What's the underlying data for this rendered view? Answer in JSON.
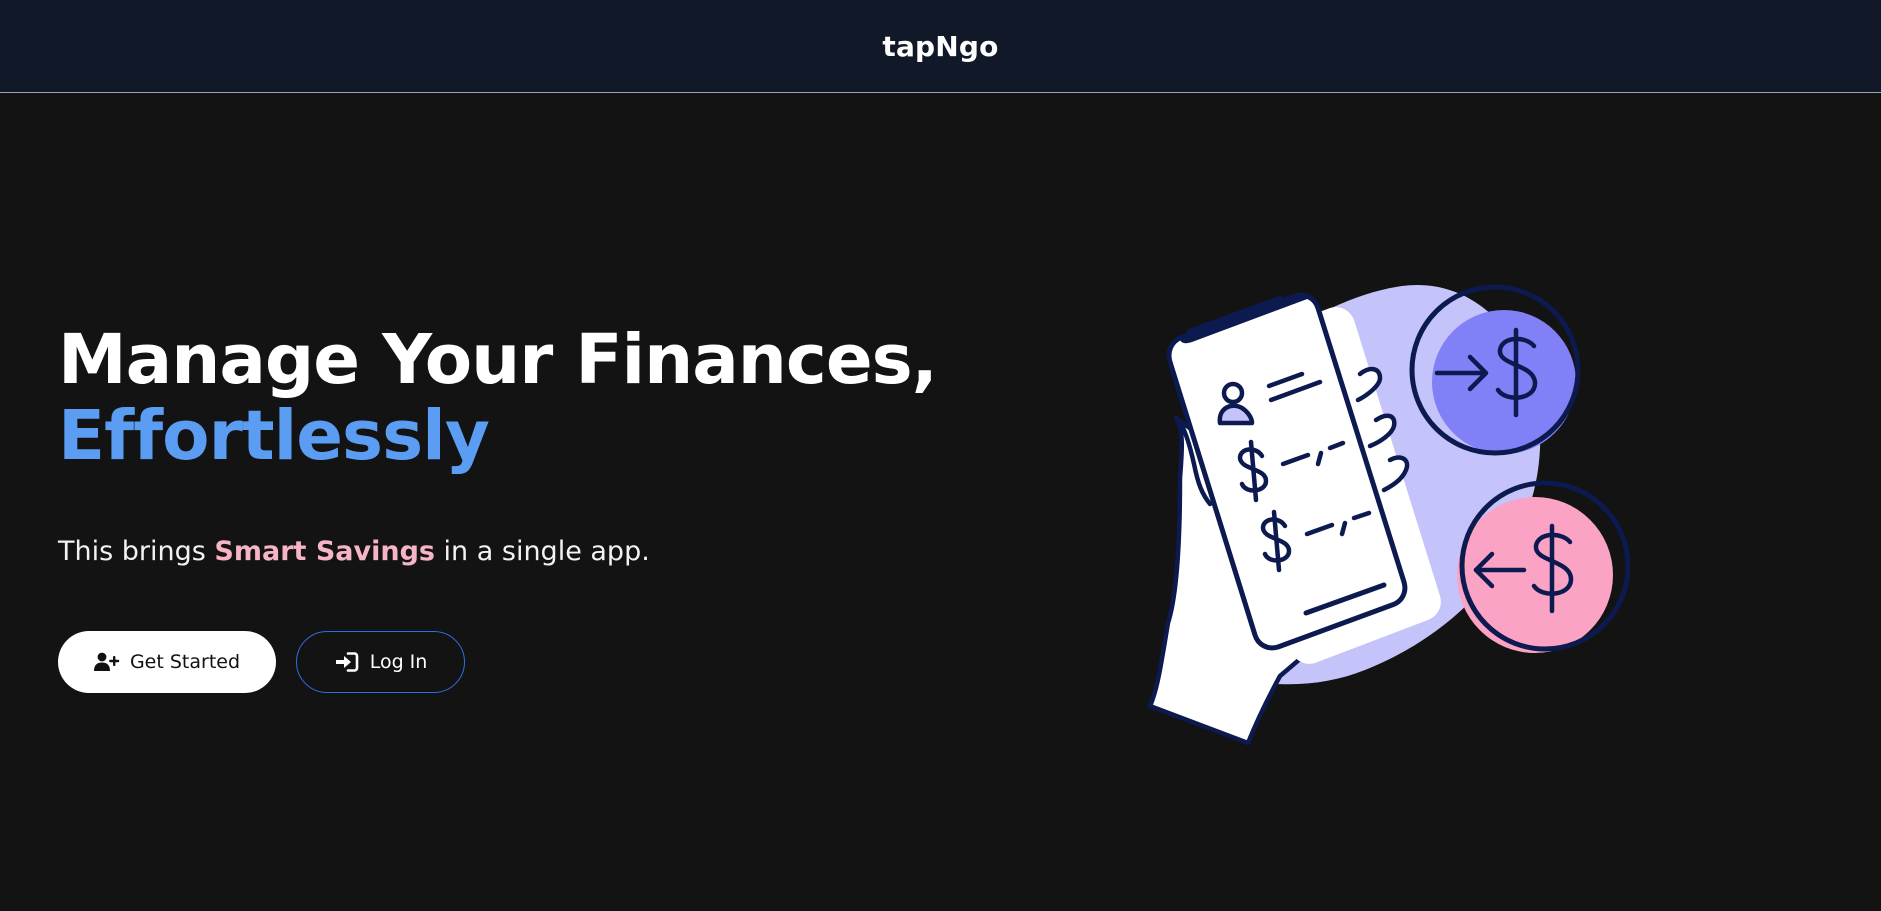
{
  "header": {
    "brand": "tapNgo"
  },
  "hero": {
    "headline_line1": "Manage Your Finances,",
    "headline_line2": "Effortlessly",
    "subtitle_before": "This brings ",
    "subtitle_accent": "Smart Savings",
    "subtitle_after": " in a single app.",
    "primary_button": {
      "label": "Get Started",
      "icon": "user-plus-icon"
    },
    "secondary_button": {
      "label": "Log In",
      "icon": "sign-in-icon"
    }
  },
  "colors": {
    "background": "#131313",
    "header_background": "#111827",
    "headline_accent": "#5b9df3",
    "subtitle_accent": "#f7b4c4",
    "secondary_border": "#2f6fe0",
    "illustration_navy": "#0c1a4f",
    "illustration_lavender": "#c4c3fa",
    "illustration_blue": "#8180f7",
    "illustration_pink": "#fba3c4"
  }
}
